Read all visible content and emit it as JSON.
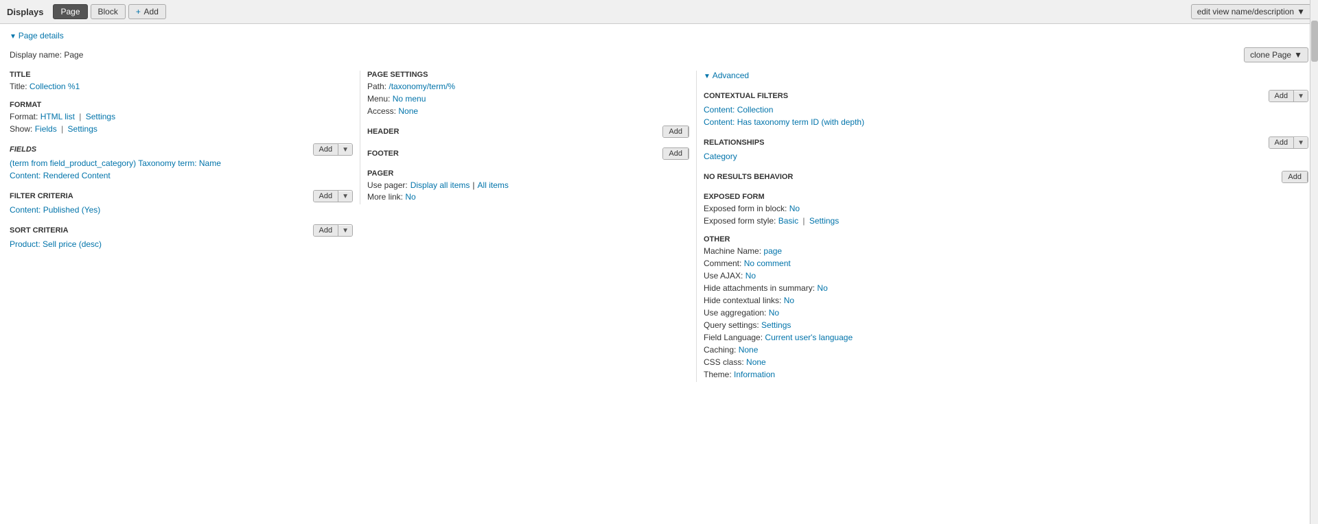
{
  "topBar": {
    "title": "Displays",
    "btn_page": "Page",
    "btn_block": "Block",
    "btn_add": "+ Add",
    "btn_edit_view": "edit view name/description"
  },
  "pageDetails": {
    "header": "Page details",
    "display_name_label": "Display name:",
    "display_name_value": "Page",
    "clone_btn": "clone Page"
  },
  "leftColumn": {
    "title_header": "TITLE",
    "title_label": "Title:",
    "title_value": "Collection %1",
    "format_header": "FORMAT",
    "format_label": "Format:",
    "format_value": "HTML list",
    "format_settings": "Settings",
    "show_label": "Show:",
    "show_value": "Fields",
    "show_settings": "Settings",
    "fields_header": "FIELDS",
    "fields_add": "Add",
    "fields_items": [
      "(term from field_product_category) Taxonomy term: Name",
      "Content: Rendered Content"
    ],
    "filter_header": "FILTER CRITERIA",
    "filter_add": "Add",
    "filter_items": [
      "Content: Published (Yes)"
    ],
    "sort_header": "SORT CRITERIA",
    "sort_add": "Add",
    "sort_items": [
      "Product: Sell price (desc)"
    ]
  },
  "midColumn": {
    "page_settings_header": "PAGE SETTINGS",
    "path_label": "Path:",
    "path_value": "/taxonomy/term/%",
    "menu_label": "Menu:",
    "menu_value": "No menu",
    "access_label": "Access:",
    "access_value": "None",
    "header_header": "HEADER",
    "header_add": "Add",
    "footer_header": "FOOTER",
    "footer_add": "Add",
    "pager_header": "PAGER",
    "use_pager_label": "Use pager:",
    "use_pager_value": "Display all items",
    "use_pager_sep": "|",
    "use_pager_all": "All items",
    "more_link_label": "More link:",
    "more_link_value": "No"
  },
  "rightColumn": {
    "advanced_header": "Advanced",
    "contextual_filters_header": "CONTEXTUAL FILTERS",
    "contextual_filters_add": "Add",
    "contextual_items": [
      "Content: Collection",
      "Content: Has taxonomy term ID (with depth)"
    ],
    "relationships_header": "RELATIONSHIPS",
    "relationships_add": "Add",
    "relationships_items": [
      "Category"
    ],
    "no_results_header": "NO RESULTS BEHAVIOR",
    "no_results_add": "Add",
    "exposed_form_header": "EXPOSED FORM",
    "exposed_block_label": "Exposed form in block:",
    "exposed_block_value": "No",
    "exposed_style_label": "Exposed form style:",
    "exposed_style_value": "Basic",
    "exposed_style_settings": "Settings",
    "other_header": "OTHER",
    "machine_name_label": "Machine Name:",
    "machine_name_value": "page",
    "comment_label": "Comment:",
    "comment_value": "No comment",
    "use_ajax_label": "Use AJAX:",
    "use_ajax_value": "No",
    "hide_attachments_label": "Hide attachments in summary:",
    "hide_attachments_value": "No",
    "hide_contextual_label": "Hide contextual links:",
    "hide_contextual_value": "No",
    "use_aggregation_label": "Use aggregation:",
    "use_aggregation_value": "No",
    "query_settings_label": "Query settings:",
    "query_settings_value": "Settings",
    "field_language_label": "Field Language:",
    "field_language_value": "Current user's language",
    "caching_label": "Caching:",
    "caching_value": "None",
    "css_class_label": "CSS class:",
    "css_class_value": "None",
    "theme_label": "Theme:",
    "theme_value": "Information"
  }
}
